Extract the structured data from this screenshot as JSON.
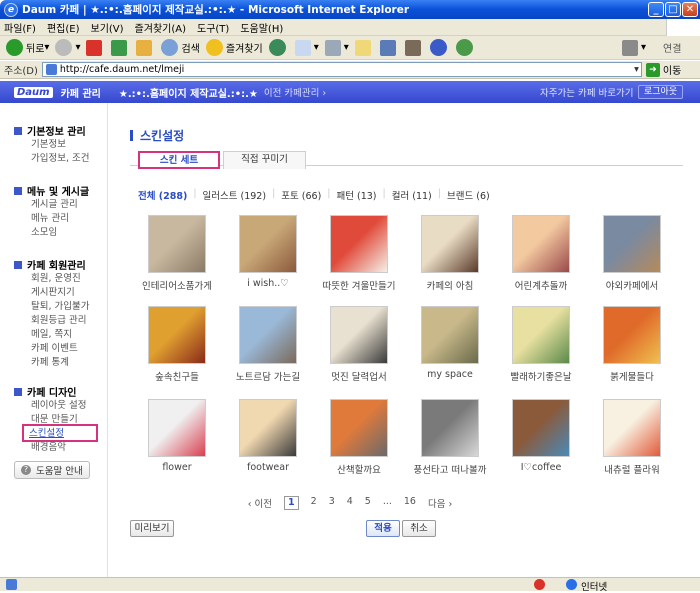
{
  "window": {
    "title": "Daum 카페 | ★.:•:.홈페이지 제작교실.:•:.★ - Microsoft Internet Explorer"
  },
  "menu": [
    "파일(F)",
    "편집(E)",
    "보기(V)",
    "즐겨찾기(A)",
    "도구(T)",
    "도움말(H)"
  ],
  "toolbar": {
    "back": "뒤로",
    "search": "검색",
    "favorites": "즐겨찾기",
    "links": "연결"
  },
  "address": {
    "label": "주소(D)",
    "url": "http://cafe.daum.net/lmeji",
    "go": "이동"
  },
  "cafe": {
    "logo": "Daum",
    "mgmt": "카페 관리",
    "name": "★.:•:.홈페이지 제작교실.:•:.★",
    "prev": "이전 카페관리 ›",
    "fav": "자주가는 카페 바로가기 ⌄",
    "logout": "로그아웃"
  },
  "sidebar": {
    "sections": [
      {
        "title": "기본정보 관리",
        "items": [
          "기본정보",
          "가입정보, 조건"
        ]
      },
      {
        "title": "메뉴 및 게시글",
        "items": [
          "게시글 관리",
          "메뉴 관리",
          "소모임"
        ]
      },
      {
        "title": "카페 회원관리",
        "items": [
          "회원, 운영진",
          "게시판지기",
          "탈퇴, 가입불가",
          "회원등급 관리",
          "메일, 쪽지",
          "카페 이벤트",
          "카페 통계"
        ]
      },
      {
        "title": "카페 디자인",
        "items": [
          "레이아웃 설정",
          "대문 만들기",
          "스킨설정",
          "배경음악"
        ]
      }
    ],
    "help": "도움말 안내"
  },
  "main": {
    "title": "스킨설정",
    "tabs": [
      "스킨 세트",
      "직접 꾸미기"
    ],
    "categories": [
      {
        "name": "전체",
        "count": "(288)"
      },
      {
        "name": "일러스트",
        "count": "(192)"
      },
      {
        "name": "포토",
        "count": "(66)"
      },
      {
        "name": "패턴",
        "count": "(13)"
      },
      {
        "name": "컬러",
        "count": "(11)"
      },
      {
        "name": "브랜드",
        "count": "(6)"
      }
    ],
    "skins": [
      {
        "label": "인테리어소품가게",
        "c1": "#c9b8a0",
        "c2": "#8a7b66"
      },
      {
        "label": "i wish..♡",
        "c1": "#c9a878",
        "c2": "#8b5a3c"
      },
      {
        "label": "따뜻한 겨울만들기",
        "c1": "#e04a3a",
        "c2": "#f5f0e8"
      },
      {
        "label": "카페의 아침",
        "c1": "#e9dcc4",
        "c2": "#5a3a2a"
      },
      {
        "label": "어린계추돌까",
        "c1": "#f3c9a0",
        "c2": "#9a4a4a"
      },
      {
        "label": "야외카페에서",
        "c1": "#7a8aa0",
        "c2": "#b58a5a"
      },
      {
        "label": "숲속친구들",
        "c1": "#e0a030",
        "c2": "#8a2a1a"
      },
      {
        "label": "노트르담 가는길",
        "c1": "#9ab8d8",
        "c2": "#7a6a5a"
      },
      {
        "label": "멋진 달력업서",
        "c1": "#e8e0d0",
        "c2": "#3a3a3a"
      },
      {
        "label": "my space",
        "c1": "#c8b88a",
        "c2": "#6a6a4a"
      },
      {
        "label": "빨래하기좋은날",
        "c1": "#e8e0a0",
        "c2": "#5a8a4a"
      },
      {
        "label": "붉게물들다",
        "c1": "#e06a2a",
        "c2": "#f0c050"
      },
      {
        "label": "flower",
        "c1": "#f0f0f0",
        "c2": "#d84050"
      },
      {
        "label": "footwear",
        "c1": "#f0d8b0",
        "c2": "#3a3a3a"
      },
      {
        "label": "산책할까요",
        "c1": "#e07a3a",
        "c2": "#6a6a6a"
      },
      {
        "label": "풍선타고 떠나볼까",
        "c1": "#7a7a7a",
        "c2": "#d8d8d8"
      },
      {
        "label": "I♡coffee",
        "c1": "#8a5a3a",
        "c2": "#4a8ab8"
      },
      {
        "label": "내츄럴 플라워",
        "c1": "#f8f0e0",
        "c2": "#e05a3a"
      }
    ],
    "pager": {
      "prev": "‹ 이전",
      "pages": [
        "1",
        "2",
        "3",
        "4",
        "5",
        "...",
        "16"
      ],
      "next": "다음 ›"
    },
    "preview": "미리보기",
    "apply": "적용",
    "cancel": "취소"
  },
  "status": {
    "zone": "인터넷"
  }
}
